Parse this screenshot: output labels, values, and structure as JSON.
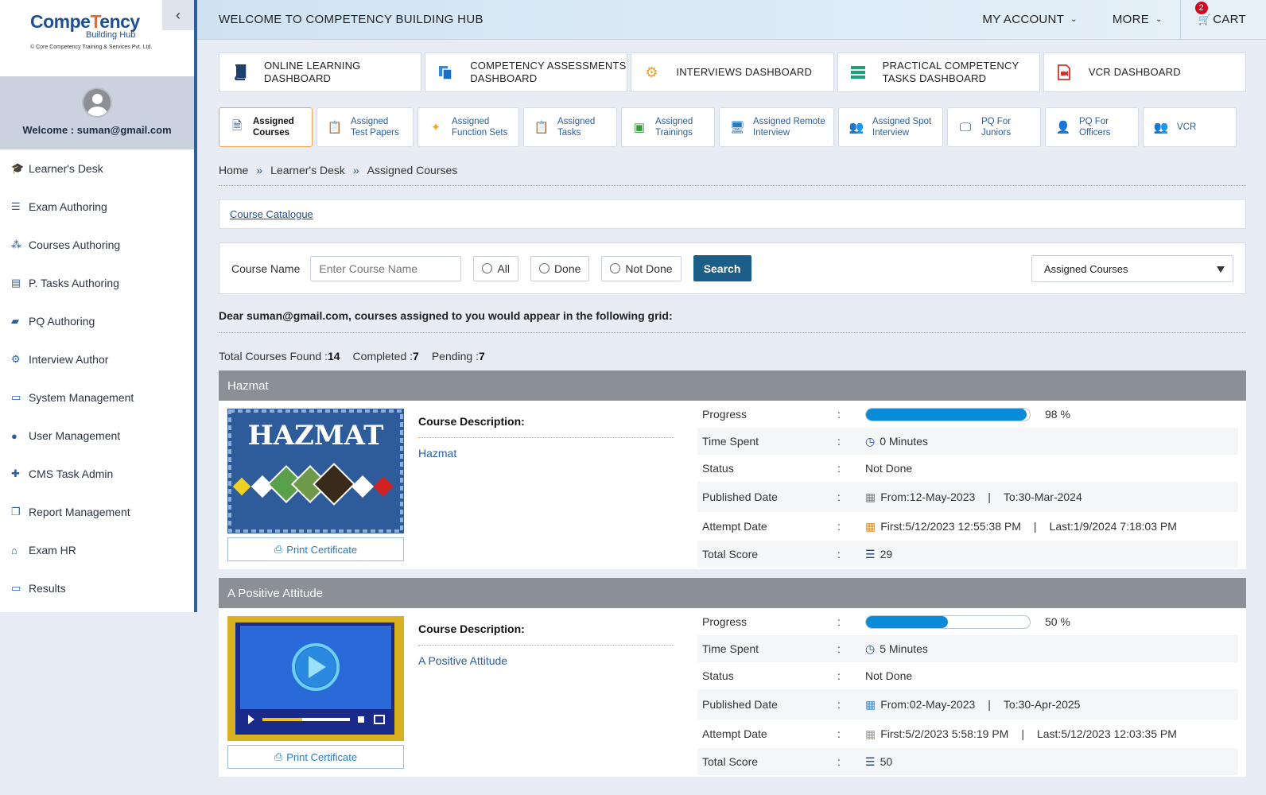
{
  "brand": {
    "name_left": "Compe",
    "name_t": "T",
    "name_right": "ency",
    "sub": "Building Hub",
    "tagline": "© Core Competency Training & Services Pvt. Ltd."
  },
  "user": {
    "welcome": "Welcome : suman@gmail.com"
  },
  "sidebar": {
    "items": [
      {
        "label": "Learner's Desk",
        "icon": "graduation-cap-icon"
      },
      {
        "label": "Exam Authoring",
        "icon": "list-icon"
      },
      {
        "label": "Courses Authoring",
        "icon": "sitemap-icon"
      },
      {
        "label": "P. Tasks Authoring",
        "icon": "tasks-icon"
      },
      {
        "label": "PQ Authoring",
        "icon": "book-icon"
      },
      {
        "label": "Interview Author",
        "icon": "gears-icon"
      },
      {
        "label": "System Management",
        "icon": "monitor-icon"
      },
      {
        "label": "User Management",
        "icon": "user-icon"
      },
      {
        "label": "CMS Task Admin",
        "icon": "user-plus-icon"
      },
      {
        "label": "Report Management",
        "icon": "copy-icon"
      },
      {
        "label": "Exam HR",
        "icon": "bank-icon"
      },
      {
        "label": "Results",
        "icon": "monitor-icon"
      }
    ]
  },
  "header": {
    "title": "WELCOME TO COMPETENCY BUILDING HUB",
    "account": "MY ACCOUNT",
    "more": "MORE",
    "cart": "CART",
    "cart_count": "2"
  },
  "dashboards": [
    {
      "line1": "ONLINE LEARNING",
      "line2": "DASHBOARD"
    },
    {
      "line1": "COMPETENCY ASSESSMENTS",
      "line2": "DASHBOARD"
    },
    {
      "line1": "INTERVIEWS DASHBOARD",
      "line2": ""
    },
    {
      "line1": "PRACTICAL COMPETENCY",
      "line2": "TASKS DASHBOARD"
    },
    {
      "line1": "VCR DASHBOARD",
      "line2": ""
    }
  ],
  "tabs": [
    {
      "line1": "Assigned",
      "line2": "Courses"
    },
    {
      "line1": "Assigned",
      "line2": "Test Papers"
    },
    {
      "line1": "Assigned",
      "line2": "Function Sets"
    },
    {
      "line1": "Assigned",
      "line2": "Tasks"
    },
    {
      "line1": "Assigned",
      "line2": "Trainings"
    },
    {
      "line1": "Assigned Remote",
      "line2": "Interview"
    },
    {
      "line1": "Assigned Spot",
      "line2": "Interview"
    },
    {
      "line1": "PQ For",
      "line2": "Juniors"
    },
    {
      "line1": "PQ For",
      "line2": "Officers"
    },
    {
      "line1": "VCR",
      "line2": ""
    }
  ],
  "breadcrumb": {
    "home": "Home",
    "level1": "Learner's Desk",
    "current": "Assigned Courses",
    "sep": "»"
  },
  "catalogue_link": "Course Catalogue",
  "filter": {
    "label": "Course Name",
    "placeholder": "Enter Course Name",
    "opt_all": "All",
    "opt_done": "Done",
    "opt_notdone": "Not Done",
    "search": "Search",
    "select_value": "Assigned Courses"
  },
  "notice": "Dear suman@gmail.com, courses assigned to you would appear in the following grid:",
  "stats": {
    "total_label": "Total Courses Found :",
    "total": "14",
    "completed_label": "Completed :",
    "completed": "7",
    "pending_label": "Pending :",
    "pending": "7"
  },
  "labels": {
    "desc": "Course Description:",
    "print": "Print Certificate",
    "progress": "Progress",
    "time": "Time Spent",
    "status": "Status",
    "published": "Published Date",
    "attempt": "Attempt Date",
    "score": "Total Score",
    "colon": ":",
    "pipe": "|"
  },
  "courses": [
    {
      "title": "Hazmat",
      "thumb_text": "HAZMAT",
      "description": "Hazmat",
      "progress": 98,
      "progress_text": "98 %",
      "time": "0 Minutes",
      "status": "Not Done",
      "pub_from": "From:12-May-2023",
      "pub_to": "To:30-Mar-2024",
      "att_first": "First:5/12/2023 12:55:38 PM",
      "att_last": "Last:1/9/2024 7:18:03 PM",
      "score": "29"
    },
    {
      "title": "A Positive Attitude",
      "thumb_text": "",
      "description": "A Positive Attitude",
      "progress": 50,
      "progress_text": "50 %",
      "time": "5 Minutes",
      "status": "Not Done",
      "pub_from": "From:02-May-2023",
      "pub_to": "To:30-Apr-2025",
      "att_first": "First:5/2/2023 5:58:19 PM",
      "att_last": "Last:5/12/2023 12:03:35 PM",
      "score": "50"
    }
  ],
  "colors": {
    "sidebar_accent": "#2a5e9c",
    "search_btn": "#1d5e88",
    "progress": "#0a8bd8",
    "course_header": "#8b8f96",
    "active_tab_border": "#f0a058"
  }
}
